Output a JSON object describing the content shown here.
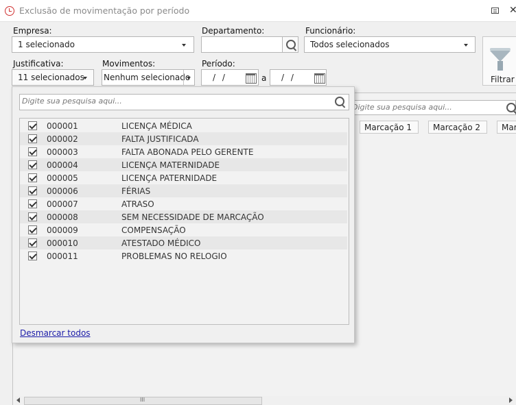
{
  "window": {
    "title": "Exclusão de movimentação por período",
    "close_glyph": "✕"
  },
  "filters": {
    "empresa": {
      "label": "Empresa:",
      "value": "1 selecionado"
    },
    "departamento": {
      "label": "Departamento:",
      "value": ""
    },
    "funcionario": {
      "label": "Funcionário:",
      "value": "Todos selecionados"
    },
    "justificativa": {
      "label": "Justificativa:",
      "value": "11 selecionados"
    },
    "movimentos": {
      "label": "Movimentos:",
      "value": "Nenhum selecionado"
    },
    "periodo": {
      "label": "Período:",
      "start": " /  /",
      "separator": "a",
      "end": " /  /"
    },
    "filter_button": "Filtrar"
  },
  "grid": {
    "search_placeholder": "Digite sua pesquisa aqui...",
    "columns": [
      "Marcação 1",
      "Marcação 2",
      "Mar"
    ]
  },
  "popup": {
    "search_placeholder": "Digite sua pesquisa aqui...",
    "items": [
      {
        "code": "000001",
        "label": "LICENÇA MÉDICA",
        "checked": true
      },
      {
        "code": "000002",
        "label": "FALTA JUSTIFICADA",
        "checked": true
      },
      {
        "code": "000003",
        "label": "FALTA ABONADA PELO GERENTE",
        "checked": true
      },
      {
        "code": "000004",
        "label": "LICENÇA MATERNIDADE",
        "checked": true
      },
      {
        "code": "000005",
        "label": "LICENÇA PATERNIDADE",
        "checked": true
      },
      {
        "code": "000006",
        "label": "FÉRIAS",
        "checked": true
      },
      {
        "code": "000007",
        "label": "ATRASO",
        "checked": true
      },
      {
        "code": "000008",
        "label": "SEM NECESSIDADE DE MARCAÇÃO",
        "checked": true
      },
      {
        "code": "000009",
        "label": "COMPENSAÇÃO",
        "checked": true
      },
      {
        "code": "000010",
        "label": "ATESTADO MÉDICO",
        "checked": true
      },
      {
        "code": "000011",
        "label": "PROBLEMAS NO RELOGIO",
        "checked": true
      }
    ],
    "uncheck_all_link": "Desmarcar todos"
  },
  "scrollbar": {
    "thumb_grip": "III"
  }
}
